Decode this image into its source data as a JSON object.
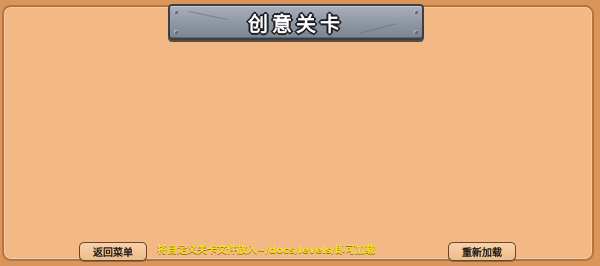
{
  "title": "创意关卡",
  "buttons": {
    "back_label": "返回菜单",
    "reload_label": "重新加载"
  },
  "hint_text": "将自定义关卡文件放入~/docs/levels/即可加载",
  "colors": {
    "background": "#d9955a",
    "panel": "#f2b885",
    "panel_border": "#b7733f",
    "title_plate": "#8f96a3",
    "hint_text": "#f7e12b"
  }
}
